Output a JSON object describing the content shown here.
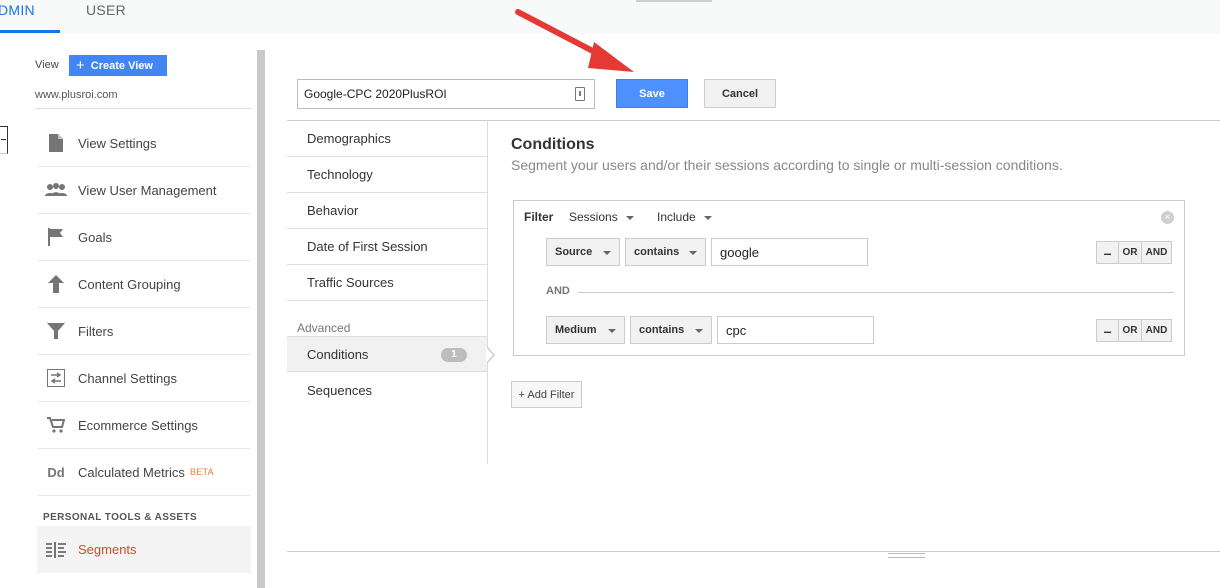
{
  "top_tabs": {
    "admin": "DMIN",
    "user": "USER"
  },
  "sidebar": {
    "view_label": "View",
    "create_view": "Create View",
    "site_url": "www.plusroi.com",
    "items": [
      {
        "label": "View Settings",
        "icon": "document-icon"
      },
      {
        "label": "View User Management",
        "icon": "users-icon"
      },
      {
        "label": "Goals",
        "icon": "flag-icon"
      },
      {
        "label": "Content Grouping",
        "icon": "content-grouping-icon"
      },
      {
        "label": "Filters",
        "icon": "funnel-icon"
      },
      {
        "label": "Channel Settings",
        "icon": "channel-settings-icon"
      },
      {
        "label": "Ecommerce Settings",
        "icon": "cart-icon"
      },
      {
        "label": "Calculated Metrics",
        "icon": "dd-icon",
        "badge": "BETA"
      }
    ],
    "section_heading": "PERSONAL TOOLS & ASSETS",
    "active_item": {
      "label": "Segments",
      "icon": "segments-icon"
    }
  },
  "editor": {
    "segment_name": "Google-CPC 2020PlusROI",
    "save_label": "Save",
    "cancel_label": "Cancel"
  },
  "categories": {
    "items": [
      "Demographics",
      "Technology",
      "Behavior",
      "Date of First Session",
      "Traffic Sources"
    ],
    "advanced_heading": "Advanced",
    "conditions": {
      "label": "Conditions",
      "count": "1"
    },
    "sequences": "Sequences"
  },
  "conditions": {
    "title": "Conditions",
    "subtitle": "Segment your users and/or their sessions according to single or multi-session conditions.",
    "filter": {
      "label": "Filter",
      "scope": "Sessions",
      "mode": "Include",
      "rows": [
        {
          "dimension": "Source",
          "operator": "contains",
          "value": "google"
        },
        {
          "dimension": "Medium",
          "operator": "contains",
          "value": "cpc"
        }
      ],
      "and_label": "AND",
      "buttons": {
        "minus": "–",
        "or": "OR",
        "and": "AND"
      }
    },
    "add_filter": "+ Add Filter"
  },
  "colors": {
    "primary": "#4d90fe",
    "accent_red": "#e53935",
    "active_text": "#d14a2a"
  }
}
